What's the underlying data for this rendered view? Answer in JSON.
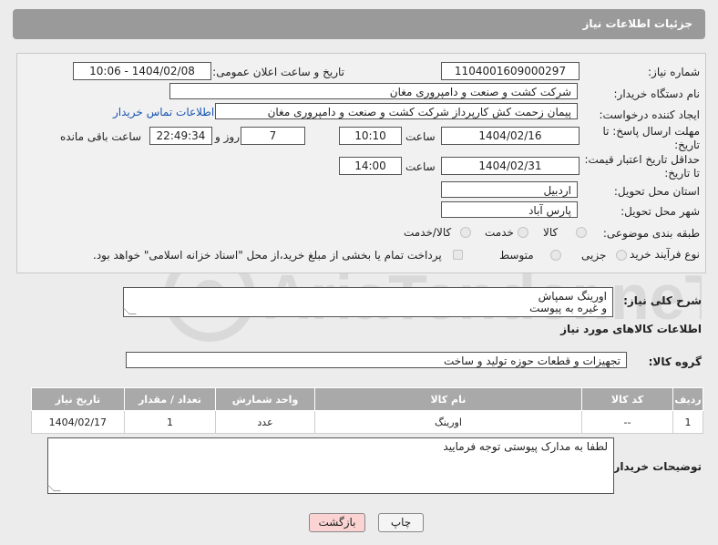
{
  "header": {
    "title": "جزئیات اطلاعات نیاز"
  },
  "form": {
    "need_number_label": "شماره نیاز:",
    "need_number": "1104001609000297",
    "announce_label": "تاریخ و ساعت اعلان عمومی:",
    "announce_value": "1404/02/08 - 10:06",
    "buyer_org_label": "نام دستگاه خریدار:",
    "buyer_org": "شرکت کشت و صنعت و دامپروری مغان",
    "creator_label": "ایجاد کننده درخواست:",
    "creator": "پیمان زحمت کش کارپرداز شرکت کشت و صنعت و دامپروری مغان",
    "contact_link": "اطلاعات تماس خریدار",
    "reply_deadline_label": "مهلت ارسال پاسخ: تا تاریخ:",
    "reply_date": "1404/02/16",
    "hour_label": "ساعت",
    "reply_time": "10:10",
    "days": "7",
    "days_label": "روز و",
    "remaining": "22:49:34",
    "remaining_label": "ساعت باقی مانده",
    "price_validity_label": "حداقل تاریخ اعتبار قیمت: تا تاریخ:",
    "price_date": "1404/02/31",
    "price_hour_label": "ساعت",
    "price_time": "14:00",
    "province_label": "استان محل تحویل:",
    "province": "اردبیل",
    "city_label": "شهر محل تحویل:",
    "city": "پارس آباد",
    "category_label": "طبقه بندی موضوعی:",
    "category_options": [
      "کالا",
      "خدمت",
      "کالا/خدمت"
    ],
    "purchase_type_label": "نوع فرآیند خرید :",
    "purchase_options": [
      "جزیی",
      "متوسط"
    ],
    "payment_note": "پرداخت تمام یا بخشی از مبلغ خرید،از محل \"اسناد خزانه اسلامی\" خواهد بود."
  },
  "description": {
    "label": "شرح کلی نیاز:",
    "line1": "اورینگ سمپاش",
    "line2": "و غیره به پیوست"
  },
  "goods_info": {
    "title": "اطلاعات کالاهای مورد نیاز"
  },
  "goods_group": {
    "label": "گروه کالا:",
    "value": "تجهیزات و قطعات حوزه تولید و ساخت"
  },
  "table": {
    "headers": [
      "ردیف",
      "کد کالا",
      "نام کالا",
      "واحد شمارش",
      "تعداد / مقدار",
      "تاریخ نیاز"
    ],
    "rows": [
      [
        "1",
        "--",
        "اورینگ",
        "عدد",
        "1",
        "1404/02/17"
      ]
    ]
  },
  "buyer_notes": {
    "label": "توضیحات خریدار:",
    "text": "لطفا به مدارک پیوستی توجه فرمایید"
  },
  "buttons": {
    "print": "چاپ",
    "back": "بازگشت"
  },
  "watermark": {
    "text": "AriaTender.neT"
  }
}
